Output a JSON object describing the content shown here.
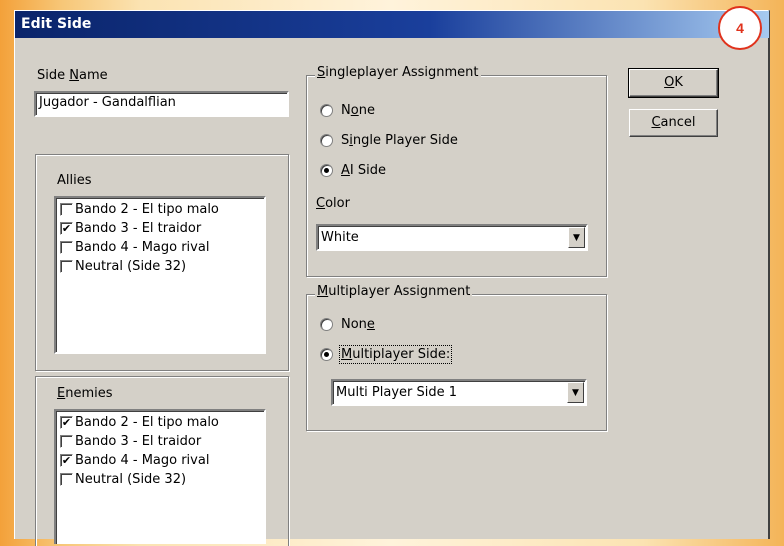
{
  "dialog": {
    "title": "Edit Side"
  },
  "badge": "4",
  "side_name": {
    "label_pre": "Side ",
    "label_accel": "N",
    "label_post": "ame",
    "value": "Jugador - Gandalflian"
  },
  "allies": {
    "label": "Allies",
    "items": [
      {
        "label": "Bando 2 - El tipo malo",
        "checked": false
      },
      {
        "label": "Bando 3 - El traidor",
        "checked": true
      },
      {
        "label": "Bando 4 - Mago rival",
        "checked": false
      },
      {
        "label": "Neutral (Side 32)",
        "checked": false
      }
    ]
  },
  "enemies": {
    "label_accel": "E",
    "label_post": "nemies",
    "items": [
      {
        "label": "Bando 2 - El tipo malo",
        "checked": true
      },
      {
        "label": "Bando 3 - El traidor",
        "checked": false
      },
      {
        "label": "Bando 4 - Mago rival",
        "checked": true
      },
      {
        "label": "Neutral (Side 32)",
        "checked": false
      }
    ]
  },
  "singleplayer": {
    "title_accel": "S",
    "title_post": "ingleplayer Assignment",
    "none_pre": "N",
    "none_accel": "o",
    "none_post": "ne",
    "single_pre": "S",
    "single_accel": "i",
    "single_post": "ngle Player Side",
    "ai_accel": "A",
    "ai_post": "I Side",
    "color_accel": "C",
    "color_post": "olor",
    "color_value": "White",
    "selected": "ai"
  },
  "multiplayer": {
    "title_accel": "M",
    "title_post": "ultiplayer Assignment",
    "none_pre": "Non",
    "none_accel": "e",
    "none_post": "",
    "multi_accel": "M",
    "multi_post": "ultiplayer Side:",
    "combo_value": "Multi Player Side 1",
    "selected": "multi"
  },
  "buttons": {
    "ok_accel": "O",
    "ok_post": "K",
    "cancel_accel": "C",
    "cancel_post": "ancel"
  },
  "icons": {
    "check": "✔",
    "dropdown": "▼"
  }
}
